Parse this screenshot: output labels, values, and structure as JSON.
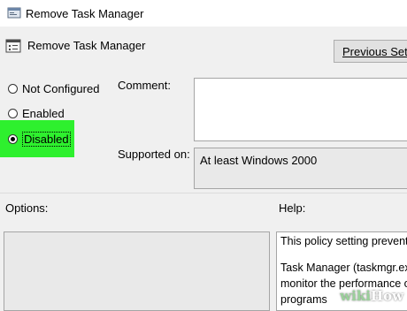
{
  "window": {
    "title": "Remove Task Manager"
  },
  "header": {
    "title": "Remove Task Manager",
    "previous_button": "Previous Setting"
  },
  "options": {
    "not_configured": "Not Configured",
    "enabled": "Enabled",
    "disabled": "Disabled",
    "selected": "Disabled"
  },
  "fields": {
    "comment_label": "Comment:",
    "supported_label": "Supported on:",
    "supported_value": "At least Windows 2000"
  },
  "sections": {
    "options_label": "Options:",
    "help_label": "Help:"
  },
  "help": {
    "line1": "This policy setting prevents u",
    "line2": "Task Manager (taskmgr.exe)",
    "line3": "monitor the performance o",
    "line4": "programs"
  },
  "watermark": {
    "wiki": "wiki",
    "how": "How"
  },
  "colors": {
    "highlight": "#2ef02e"
  }
}
